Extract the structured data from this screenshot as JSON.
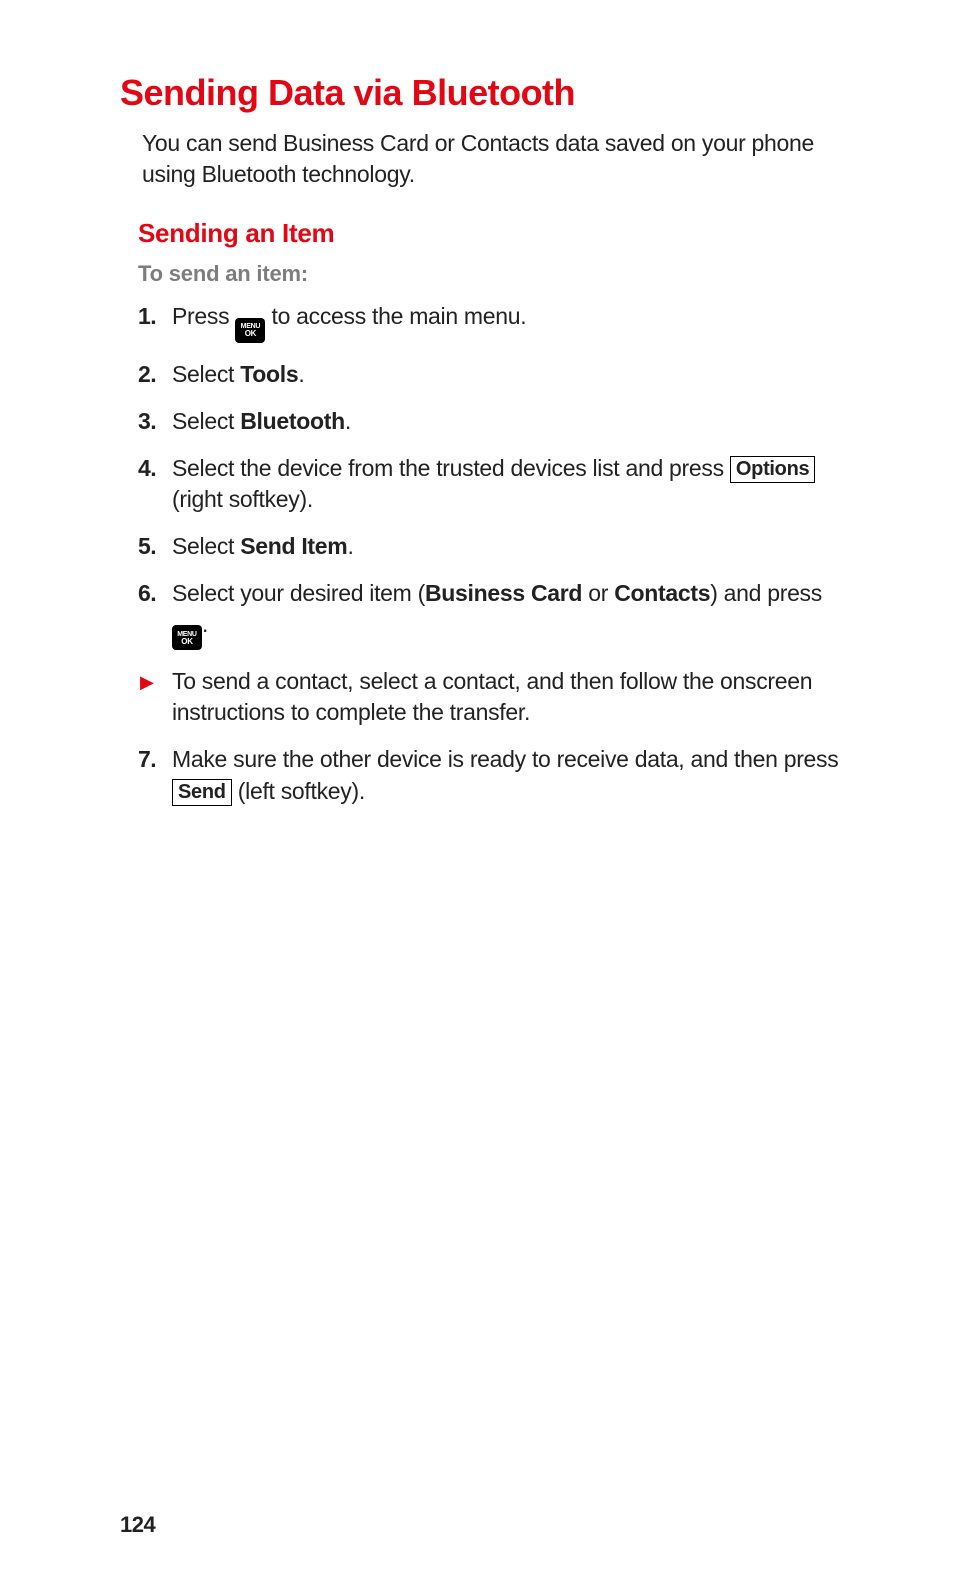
{
  "title": "Sending Data via Bluetooth",
  "intro": "You can send Business Card or Contacts data saved on your phone using Bluetooth technology.",
  "subtitle": "Sending an Item",
  "lead": "To send an item:",
  "menuok": {
    "line1": "MENU",
    "line2": "OK"
  },
  "softkeys": {
    "options": "Options",
    "send": "Send"
  },
  "steps": {
    "s1": {
      "num": "1.",
      "t1": "Press ",
      "t2": " to access the main menu."
    },
    "s2": {
      "num": "2.",
      "t1": "Select ",
      "b1": "Tools",
      "t2": "."
    },
    "s3": {
      "num": "3.",
      "t1": "Select ",
      "b1": "Bluetooth",
      "t2": "."
    },
    "s4": {
      "num": "4.",
      "t1": "Select the device from the trusted devices list and press ",
      "t2": " (right softkey)."
    },
    "s5": {
      "num": "5.",
      "t1": "Select ",
      "b1": "Send Item",
      "t2": "."
    },
    "s6": {
      "num": "6.",
      "t1": "Select your desired item (",
      "b1": "Business Card",
      "t2": " or ",
      "b2": "Contacts",
      "t3": ") and press ",
      "t4": "."
    },
    "sub": {
      "text": "To send a contact, select a contact, and then follow the onscreen instructions to complete the transfer."
    },
    "s7": {
      "num": "7.",
      "t1": "Make sure the other device is ready to receive data, and then press ",
      "t2": " (left softkey)."
    }
  },
  "pageNumber": "124"
}
